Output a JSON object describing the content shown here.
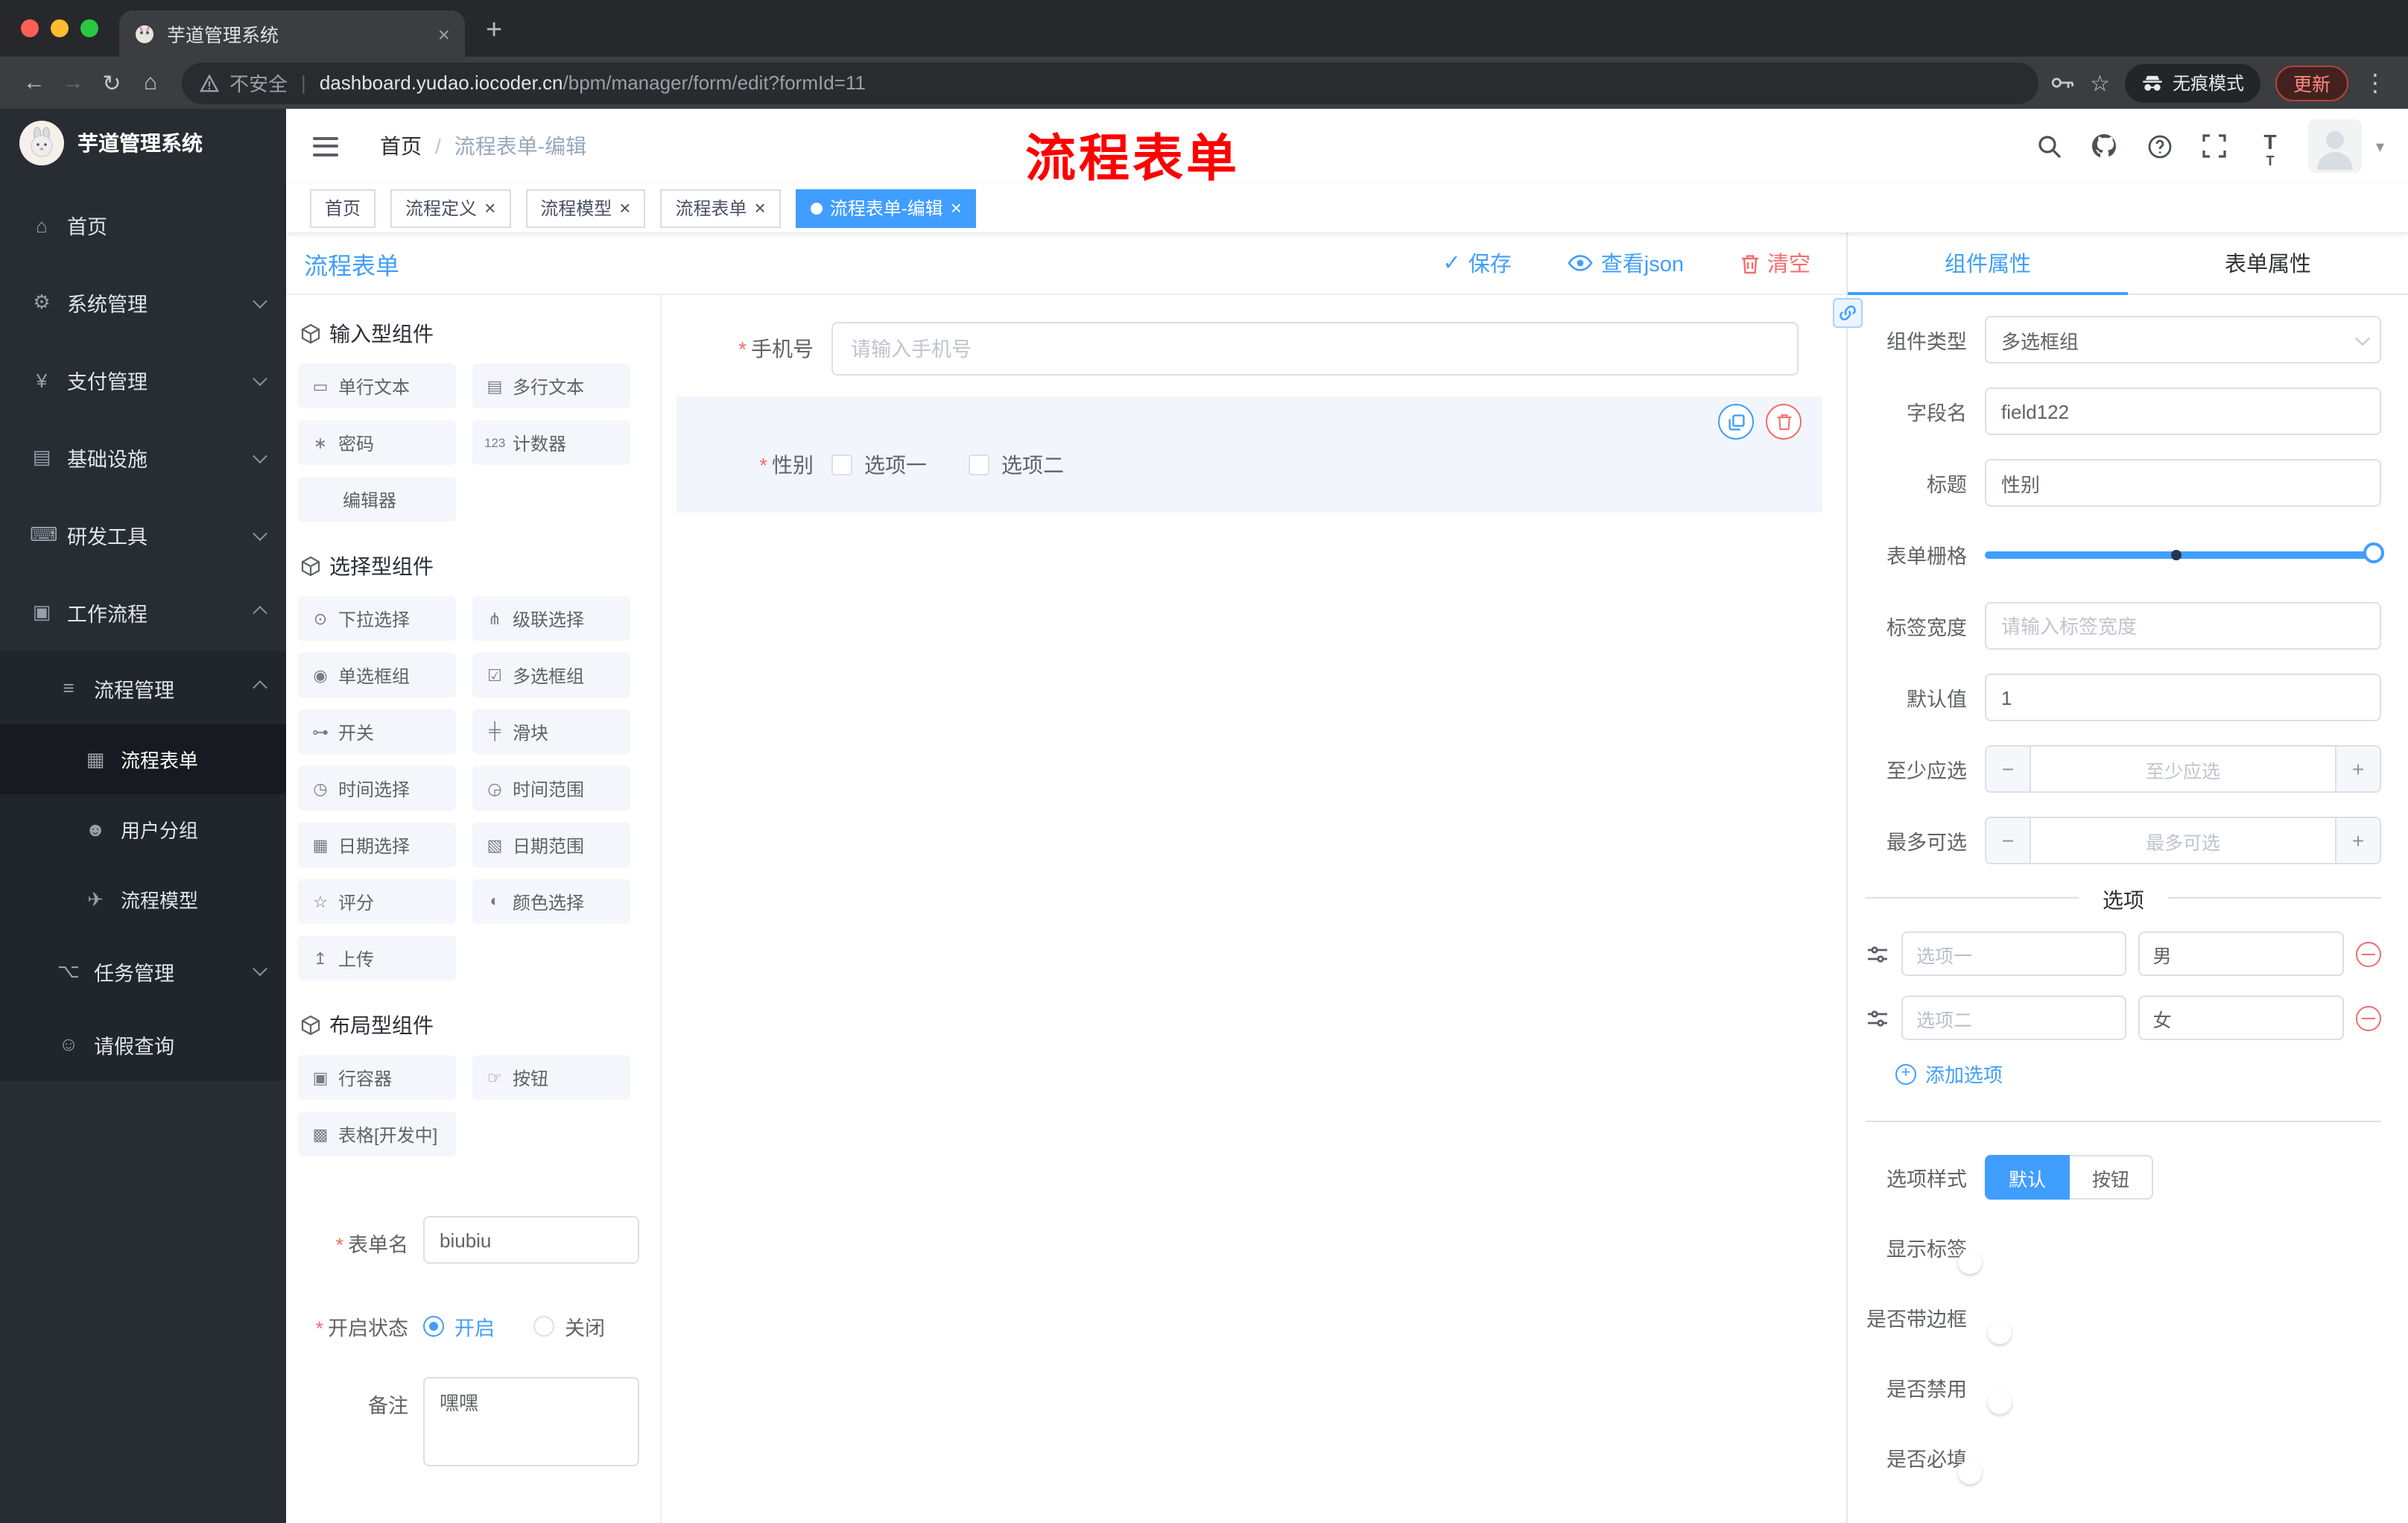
{
  "colors": {
    "accent": "#409eff",
    "danger": "#f56c6c",
    "annotation": "#fe0000"
  },
  "browser": {
    "tab_title": "芋道管理系统",
    "security_label": "不安全",
    "url_domain": "dashboard.yudao.iocoder.cn",
    "url_path": "/bpm/manager/form/edit?formId=11",
    "incognito_label": "无痕模式",
    "update_label": "更新"
  },
  "sidebar": {
    "logo_title": "芋道管理系统",
    "items": [
      {
        "name": "home",
        "label": "首页",
        "icon": "⌂",
        "depth": 0
      },
      {
        "name": "system-management",
        "label": "系统管理",
        "icon": "⚙",
        "depth": 0,
        "chevron": "down"
      },
      {
        "name": "payment-management",
        "label": "支付管理",
        "icon": "¥",
        "depth": 0,
        "chevron": "down"
      },
      {
        "name": "infrastructure",
        "label": "基础设施",
        "icon": "▤",
        "depth": 0,
        "chevron": "down"
      },
      {
        "name": "dev-tools",
        "label": "研发工具",
        "icon": "⌨",
        "depth": 0,
        "chevron": "down"
      },
      {
        "name": "workflow",
        "label": "工作流程",
        "icon": "▣",
        "depth": 0,
        "chevron": "up"
      },
      {
        "name": "process-management",
        "label": "流程管理",
        "icon": "≡",
        "depth": 1,
        "chevron": "up"
      },
      {
        "name": "process-form",
        "label": "流程表单",
        "icon": "▦",
        "depth": 2,
        "active": true
      },
      {
        "name": "user-group",
        "label": "用户分组",
        "icon": "☻",
        "depth": 2
      },
      {
        "name": "process-model",
        "label": "流程模型",
        "icon": "✈",
        "depth": 2
      },
      {
        "name": "task-management",
        "label": "任务管理",
        "icon": "⌥",
        "depth": 1,
        "chevron": "down"
      },
      {
        "name": "leave-query",
        "label": "请假查询",
        "icon": "☺",
        "depth": 1
      }
    ]
  },
  "header": {
    "breadcrumb": [
      "首页",
      "流程表单-编辑"
    ],
    "breadcrumb_sep": "/",
    "annotation": "流程表单"
  },
  "tags_view": {
    "tabs": [
      {
        "name": "home",
        "label": "首页",
        "closable": false,
        "active": false
      },
      {
        "name": "process-definition",
        "label": "流程定义",
        "closable": true,
        "active": false
      },
      {
        "name": "process-model",
        "label": "流程模型",
        "closable": true,
        "active": false
      },
      {
        "name": "process-form",
        "label": "流程表单",
        "closable": true,
        "active": false
      },
      {
        "name": "process-form-edit",
        "label": "流程表单-编辑",
        "closable": true,
        "active": true
      }
    ]
  },
  "designer": {
    "title": "流程表单",
    "actions": {
      "save": "保存",
      "view_json": "查看json",
      "clear": "清空"
    },
    "palette": {
      "sections": [
        {
          "title": "输入型组件",
          "items": [
            {
              "name": "single-line-text",
              "label": "单行文本",
              "icon": "▭"
            },
            {
              "name": "multi-line-text",
              "label": "多行文本",
              "icon": "▤"
            },
            {
              "name": "password",
              "label": "密码",
              "icon": "∗"
            },
            {
              "name": "counter",
              "label": "计数器",
              "icon": "123"
            },
            {
              "name": "editor",
              "label": "编辑器",
              "icon": ""
            }
          ]
        },
        {
          "title": "选择型组件",
          "items": [
            {
              "name": "select",
              "label": "下拉选择",
              "icon": "⊙"
            },
            {
              "name": "cascader",
              "label": "级联选择",
              "icon": "⋔"
            },
            {
              "name": "radio-group",
              "label": "单选框组",
              "icon": "◉"
            },
            {
              "name": "checkbox-group",
              "label": "多选框组",
              "icon": "☑"
            },
            {
              "name": "switch",
              "label": "开关",
              "icon": "⊶"
            },
            {
              "name": "slider",
              "label": "滑块",
              "icon": "╪"
            },
            {
              "name": "time-picker",
              "label": "时间选择",
              "icon": "◷"
            },
            {
              "name": "time-range",
              "label": "时间范围",
              "icon": "◶"
            },
            {
              "name": "date-picker",
              "label": "日期选择",
              "icon": "▦"
            },
            {
              "name": "date-range",
              "label": "日期范围",
              "icon": "▧"
            },
            {
              "name": "rate",
              "label": "评分",
              "icon": "☆"
            },
            {
              "name": "color-picker",
              "label": "颜色选择",
              "icon": "◐"
            },
            {
              "name": "upload",
              "label": "上传",
              "icon": "↥"
            }
          ]
        },
        {
          "title": "布局型组件",
          "items": [
            {
              "name": "row-container",
              "label": "行容器",
              "icon": "▣"
            },
            {
              "name": "button",
              "label": "按钮",
              "icon": "☞"
            },
            {
              "name": "table-dev",
              "label": "表格[开发中]",
              "icon": "▩"
            }
          ]
        }
      ]
    },
    "config": {
      "form_name_label": "表单名",
      "form_name_value": "biubiu",
      "status_label": "开启状态",
      "status_on": "开启",
      "status_off": "关闭",
      "remark_label": "备注",
      "remark_value": "嘿嘿"
    },
    "canvas": {
      "phone_label": "手机号",
      "phone_placeholder": "请输入手机号",
      "gender_label": "性别",
      "gender_options": [
        "选项一",
        "选项二"
      ]
    }
  },
  "props": {
    "tabs": [
      "组件属性",
      "表单属性"
    ],
    "component_type_label": "组件类型",
    "component_type_value": "多选框组",
    "field_name_label": "字段名",
    "field_name_value": "field122",
    "title_label": "标题",
    "title_value": "性别",
    "grid_label": "表单栅格",
    "label_width_label": "标签宽度",
    "label_width_placeholder": "请输入标签宽度",
    "default_label": "默认值",
    "default_value": "1",
    "min_label": "至少应选",
    "min_placeholder": "至少应选",
    "max_label": "最多可选",
    "max_placeholder": "最多可选",
    "options_divider": "选项",
    "options": [
      {
        "label": "选项一",
        "value": "男"
      },
      {
        "label": "选项二",
        "value": "女"
      }
    ],
    "add_option": "添加选项",
    "style_label": "选项样式",
    "style_options": [
      "默认",
      "按钮"
    ],
    "style_active": 0,
    "switches": [
      {
        "name": "show-label",
        "label": "显示标签",
        "on": true
      },
      {
        "name": "bordered",
        "label": "是否带边框",
        "on": false
      },
      {
        "name": "disabled",
        "label": "是否禁用",
        "on": false
      },
      {
        "name": "required",
        "label": "是否必填",
        "on": true
      }
    ]
  }
}
